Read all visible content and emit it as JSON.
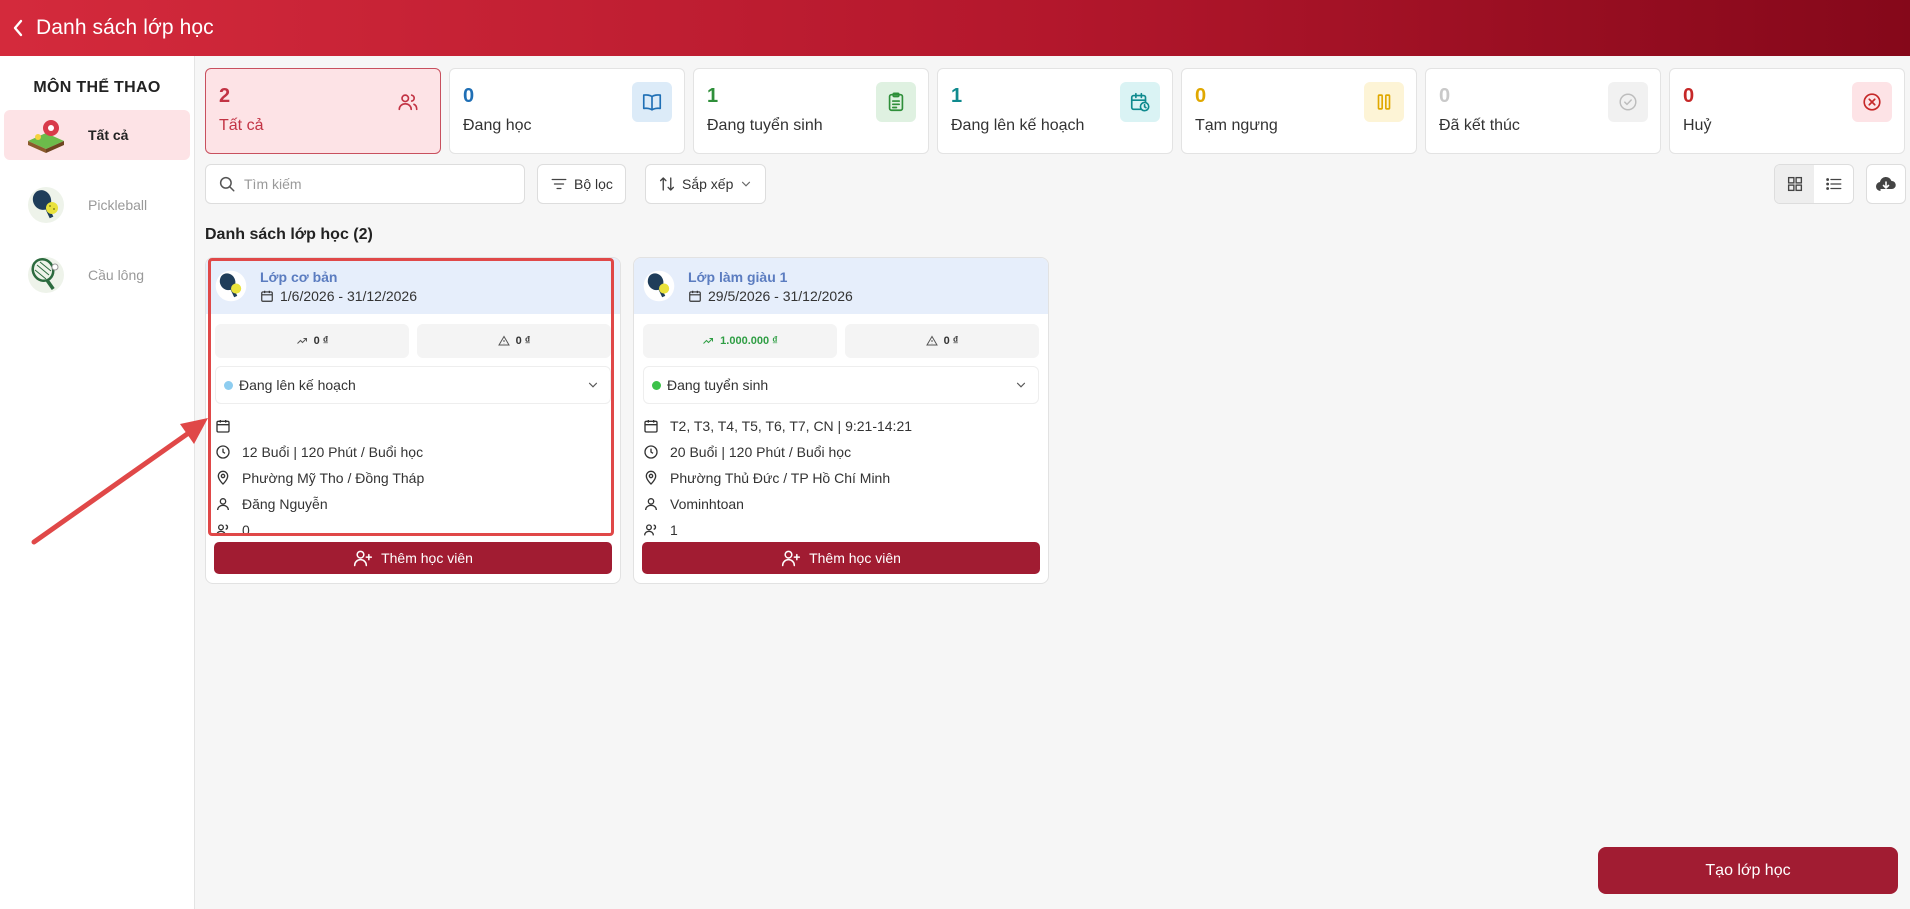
{
  "header": {
    "title": "Danh sách lớp học"
  },
  "sidebar": {
    "heading": "MÔN THỂ THAO",
    "items": [
      {
        "label": "Tất cả"
      },
      {
        "label": "Pickleball"
      },
      {
        "label": "Cầu lông"
      }
    ]
  },
  "stats": [
    {
      "count": "2",
      "label": "Tất cả",
      "color": "#c23344",
      "icon_bg": "#fde3e6",
      "icon": "users-icon"
    },
    {
      "count": "0",
      "label": "Đang học",
      "color": "#1f6fb5",
      "icon_bg": "#dcebf8",
      "icon": "book-icon"
    },
    {
      "count": "1",
      "label": "Đang tuyển sinh",
      "color": "#2f8f3a",
      "icon_bg": "#dff1e1",
      "icon": "clipboard-icon"
    },
    {
      "count": "1",
      "label": "Đang lên kế hoạch",
      "color": "#0f8a8e",
      "icon_bg": "#daf3f4",
      "icon": "calendar-clock-icon"
    },
    {
      "count": "0",
      "label": "Tạm ngưng",
      "color": "#e0a800",
      "icon_bg": "#fdf4d6",
      "icon": "pause-icon"
    },
    {
      "count": "0",
      "label": "Đã kết thúc",
      "color": "#c9c9c9",
      "icon_bg": "#f1f1f1",
      "icon": "check-circle-icon"
    },
    {
      "count": "0",
      "label": "Huỷ",
      "color": "#c62828",
      "icon_bg": "#fde3e6",
      "icon": "x-circle-icon"
    }
  ],
  "toolbar": {
    "search_placeholder": "Tìm kiếm",
    "filter_label": "Bộ lọc",
    "sort_label": "Sắp xếp"
  },
  "list": {
    "title": "Danh sách lớp học (2)",
    "classes": [
      {
        "name": "Lớp cơ bản",
        "dates": "1/6/2026 - 31/12/2026",
        "revenue": "0 ₫",
        "debt": "0 ₫",
        "status": "Đang lên kế hoạch",
        "status_color": "#8ecdf0",
        "schedule": "",
        "sessions": "12 Buổi | 120 Phút / Buổi học",
        "location": "Phường Mỹ Tho / Đồng Tháp",
        "coach": "Đăng Nguyễn",
        "students": "0",
        "add_label": "Thêm học viên"
      },
      {
        "name": "Lớp làm giàu 1",
        "dates": "29/5/2026 - 31/12/2026",
        "revenue": "1.000.000 ₫",
        "debt": "0 ₫",
        "status": "Đang tuyển sinh",
        "status_color": "#3cc24a",
        "schedule": "T2, T3, T4, T5, T6, T7, CN | 9:21-14:21",
        "sessions": "20 Buổi | 120 Phút / Buổi học",
        "location": "Phường Thủ Đức / TP Hồ Chí Minh",
        "coach": "Vominhtoan",
        "students": "1",
        "add_label": "Thêm học viên"
      }
    ]
  },
  "create_button": "Tạo lớp học"
}
